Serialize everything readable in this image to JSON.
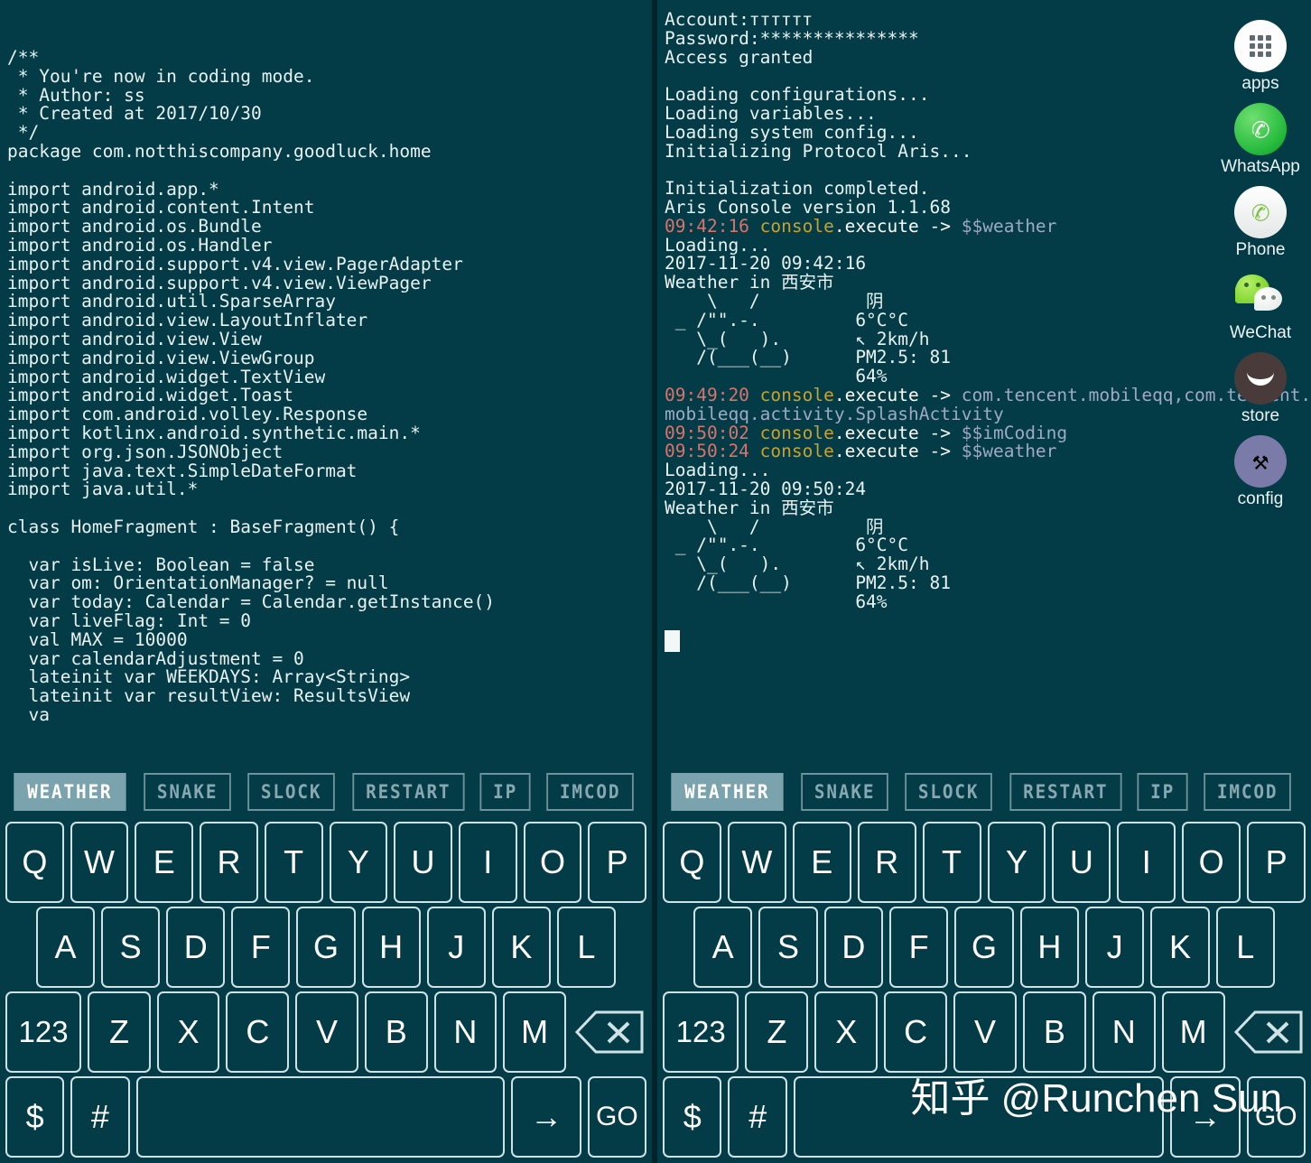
{
  "theme": {
    "background": "#033b46",
    "text": "#e8f2f2",
    "timestamp_color": "#d9736b",
    "command_color": "#c9a227",
    "argument_color": "#9fa9c4",
    "key_border": "#cfe3e6",
    "macro_border": "#6e939d",
    "macro_active_bg": "#7ba3ad"
  },
  "left_panel": {
    "name": "coding-mode-editor",
    "lines": [
      "/**",
      " * You're now in coding mode.",
      " * Author: ss",
      " * Created at 2017/10/30",
      " */",
      "package com.notthiscompany.goodluck.home",
      "",
      "import android.app.*",
      "import android.content.Intent",
      "import android.os.Bundle",
      "import android.os.Handler",
      "import android.support.v4.view.PagerAdapter",
      "import android.support.v4.view.ViewPager",
      "import android.util.SparseArray",
      "import android.view.LayoutInflater",
      "import android.view.View",
      "import android.view.ViewGroup",
      "import android.widget.TextView",
      "import android.widget.Toast",
      "import com.android.volley.Response",
      "import kotlinx.android.synthetic.main.*",
      "import org.json.JSONObject",
      "import java.text.SimpleDateFormat",
      "import java.util.*",
      "",
      "class HomeFragment : BaseFragment() {",
      "",
      "  var isLive: Boolean = false",
      "  var om: OrientationManager? = null",
      "  var today: Calendar = Calendar.getInstance()",
      "  var liveFlag: Int = 0",
      "  val MAX = 10000",
      "  var calendarAdjustment = 0",
      "  lateinit var WEEKDAYS: Array<String>",
      "  lateinit var resultView: ResultsView",
      "  va"
    ]
  },
  "right_panel": {
    "name": "aris-console",
    "lines": [
      {
        "type": "plain",
        "text": "Account:ᴛᴛᴛᴛᴛᴛ"
      },
      {
        "type": "plain",
        "text": "Password:***************"
      },
      {
        "type": "plain",
        "text": "Access granted"
      },
      {
        "type": "blank"
      },
      {
        "type": "plain",
        "text": "Loading configurations..."
      },
      {
        "type": "plain",
        "text": "Loading variables..."
      },
      {
        "type": "plain",
        "text": "Loading system config..."
      },
      {
        "type": "plain",
        "text": "Initializing Protocol Aris..."
      },
      {
        "type": "blank"
      },
      {
        "type": "plain",
        "text": "Initialization completed."
      },
      {
        "type": "plain",
        "text": "Aris Console version 1.1.68"
      },
      {
        "type": "cmd",
        "ts": "09:42:16",
        "cmd": "console",
        "method": ".execute -> ",
        "arg": "$$weather"
      },
      {
        "type": "plain",
        "text": "Loading..."
      },
      {
        "type": "plain",
        "text": "2017-11-20 09:42:16"
      },
      {
        "type": "plain",
        "text": "Weather in 西安市"
      },
      {
        "type": "plain",
        "text": "    \\   /          阴"
      },
      {
        "type": "plain",
        "text": " _ /\"\".-.         6°C°C"
      },
      {
        "type": "plain",
        "text": "   \\_(   ).       ↖ 2km/h"
      },
      {
        "type": "plain",
        "text": "   /(___(__)      PM2.5: 81"
      },
      {
        "type": "plain",
        "text": "                  64%"
      },
      {
        "type": "cmd",
        "ts": "09:49:20",
        "cmd": "console",
        "method": ".execute -> ",
        "arg": "com.tencent.mobileqq,com.tencent."
      },
      {
        "type": "argcont",
        "text": "mobileqq.activity.SplashActivity"
      },
      {
        "type": "cmd",
        "ts": "09:50:02",
        "cmd": "console",
        "method": ".execute -> ",
        "arg": "$$imCoding"
      },
      {
        "type": "cmd",
        "ts": "09:50:24",
        "cmd": "console",
        "method": ".execute -> ",
        "arg": "$$weather"
      },
      {
        "type": "plain",
        "text": "Loading..."
      },
      {
        "type": "plain",
        "text": "2017-11-20 09:50:24"
      },
      {
        "type": "plain",
        "text": "Weather in 西安市"
      },
      {
        "type": "plain",
        "text": "    \\   /          阴"
      },
      {
        "type": "plain",
        "text": " _ /\"\".-.         6°C°C"
      },
      {
        "type": "plain",
        "text": "   \\_(   ).       ↖ 2km/h"
      },
      {
        "type": "plain",
        "text": "   /(___(__)      PM2.5: 81"
      },
      {
        "type": "plain",
        "text": "                  64%"
      },
      {
        "type": "blank"
      },
      {
        "type": "cursor"
      }
    ],
    "weather_readout": {
      "city": "西安市",
      "condition": "阴",
      "temperature": "6°C°C",
      "wind": "2km/h",
      "wind_direction": "↖",
      "pm25": "PM2.5: 81",
      "humidity": "64%"
    }
  },
  "app_rail": {
    "items": [
      {
        "icon": "apps-grid-icon",
        "label": "apps"
      },
      {
        "icon": "whatsapp-icon",
        "label": "WhatsApp"
      },
      {
        "icon": "phone-icon",
        "label": "Phone"
      },
      {
        "icon": "wechat-icon",
        "label": "WeChat"
      },
      {
        "icon": "store-icon",
        "label": "store"
      },
      {
        "icon": "config-tools-icon",
        "label": "config"
      }
    ]
  },
  "macro_bar": {
    "buttons": [
      {
        "label": "WEATHER",
        "active": true
      },
      {
        "label": "SNAKE",
        "active": false
      },
      {
        "label": "SLOCK",
        "active": false
      },
      {
        "label": "RESTART",
        "active": false
      },
      {
        "label": "IP",
        "active": false
      },
      {
        "label": "IMCOD",
        "active": false
      }
    ]
  },
  "keyboard": {
    "row1": [
      "Q",
      "W",
      "E",
      "R",
      "T",
      "Y",
      "U",
      "I",
      "O",
      "P"
    ],
    "row2": [
      "A",
      "S",
      "D",
      "F",
      "G",
      "H",
      "J",
      "K",
      "L"
    ],
    "row3": [
      "123",
      "Z",
      "X",
      "C",
      "V",
      "B",
      "N",
      "M",
      "⌫"
    ],
    "row4": [
      "$",
      "#",
      " ",
      "→",
      "GO"
    ],
    "backspace_icon": "backspace-icon",
    "enter_icon": "arrow-right-icon",
    "go_label": "GO",
    "space_label": " "
  },
  "watermark": {
    "text": "知乎 @Runchen Sun"
  }
}
